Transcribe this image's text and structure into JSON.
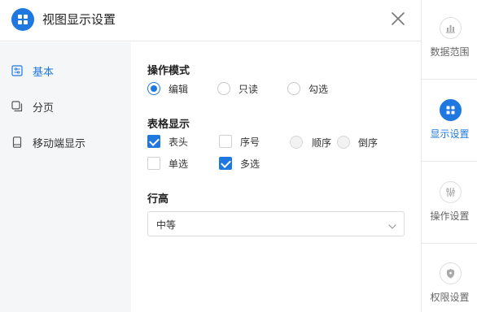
{
  "header": {
    "title": "视图显示设置",
    "logo_icon": "grid-icon",
    "close_icon": "close-icon"
  },
  "left_nav": {
    "items": [
      {
        "label": "基本",
        "icon": "sliders-icon",
        "active": true
      },
      {
        "label": "分页",
        "icon": "pages-icon",
        "active": false
      },
      {
        "label": "移动端显示",
        "icon": "mobile-icon",
        "active": false
      }
    ]
  },
  "main": {
    "mode": {
      "title": "操作模式",
      "options": [
        {
          "label": "编辑",
          "selected": true
        },
        {
          "label": "只读",
          "selected": false
        },
        {
          "label": "勾选",
          "selected": false
        }
      ]
    },
    "table": {
      "title": "表格显示",
      "checkboxes": [
        {
          "label": "表头",
          "checked": true
        },
        {
          "label": "序号",
          "checked": false
        },
        {
          "label": "单选",
          "checked": false
        },
        {
          "label": "多选",
          "checked": true
        }
      ],
      "order": [
        {
          "label": "顺序",
          "disabled": true
        },
        {
          "label": "倒序",
          "disabled": true
        }
      ]
    },
    "row_height": {
      "title": "行高",
      "value": "中等",
      "chevron_icon": "chevron-down-icon"
    }
  },
  "right_rail": {
    "items": [
      {
        "label": "数据范围",
        "icon": "bar-chart-icon",
        "active": false
      },
      {
        "label": "显示设置",
        "icon": "grid-icon",
        "active": true
      },
      {
        "label": "操作设置",
        "icon": "sliders-vertical-icon",
        "active": false
      },
      {
        "label": "权限设置",
        "icon": "shield-icon",
        "active": false
      }
    ]
  },
  "colors": {
    "accent": "#1f78e0",
    "nav_bg": "#f5f6f8",
    "border": "#e8e8e8"
  }
}
